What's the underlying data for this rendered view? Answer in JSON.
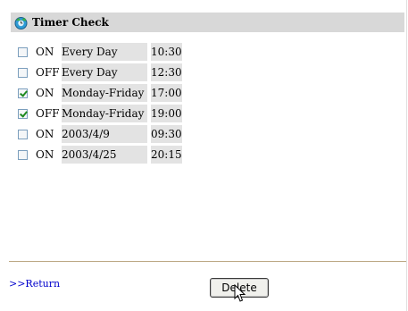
{
  "window": {
    "title": "Timer Check",
    "title_icon": "timer-clock-icon"
  },
  "timers": [
    {
      "checked": false,
      "status": "ON",
      "schedule": "Every Day",
      "time": "10:30"
    },
    {
      "checked": false,
      "status": "OFF",
      "schedule": "Every Day",
      "time": "12:30"
    },
    {
      "checked": true,
      "status": "ON",
      "schedule": "Monday-Friday",
      "time": "17:00"
    },
    {
      "checked": true,
      "status": "OFF",
      "schedule": "Monday-Friday",
      "time": "19:00"
    },
    {
      "checked": false,
      "status": "ON",
      "schedule": "2003/4/9",
      "time": "09:30"
    },
    {
      "checked": false,
      "status": "ON",
      "schedule": "2003/4/25",
      "time": "20:15"
    }
  ],
  "footer": {
    "return_label": ">>Return",
    "delete_label": "Delete"
  },
  "colors": {
    "title_bar": "#d8d8d8",
    "cell_background": "#e3e3e3",
    "link": "#0000cc",
    "divider": "#bba682",
    "check_mark": "#1f8a1f"
  }
}
